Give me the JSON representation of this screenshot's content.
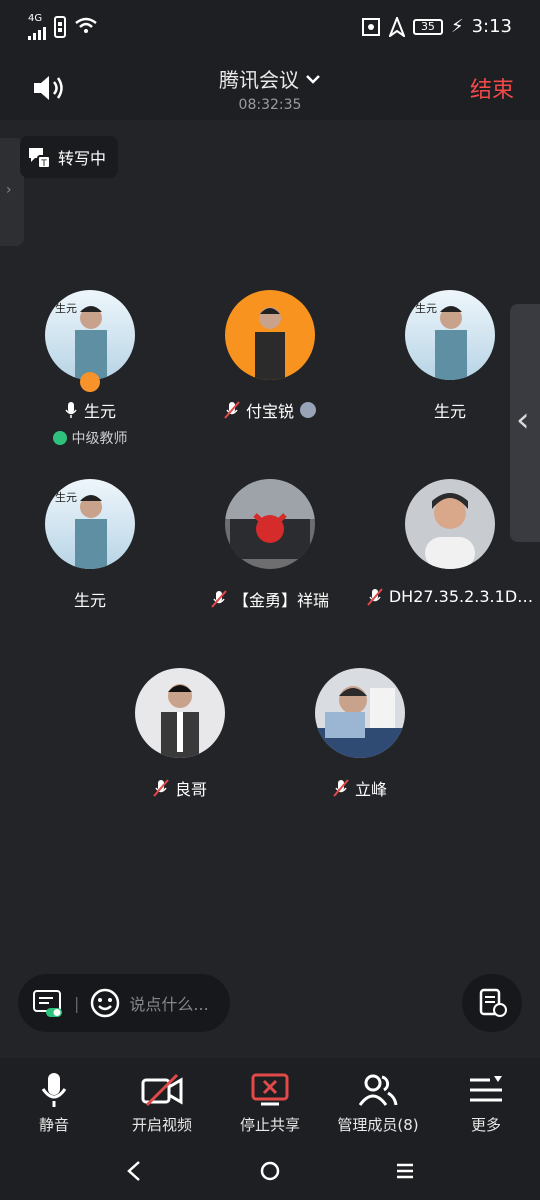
{
  "status_bar": {
    "network": "4G",
    "battery": "35",
    "time": "3:13"
  },
  "header": {
    "title": "腾讯会议",
    "timer": "08:32:35",
    "end_label": "结束"
  },
  "transcribe": {
    "label": "转写中"
  },
  "participants": [
    {
      "name": "生元",
      "sub": "中级教师",
      "avatar_color": "#cfe3f0",
      "mic": "on",
      "host": true
    },
    {
      "name": "付宝锐",
      "avatar_color": "#f7931e",
      "mic": "muted",
      "clock": true
    },
    {
      "name": "生元",
      "avatar_color": "#cfe3f0"
    },
    {
      "name": "生元",
      "avatar_color": "#cfe3f0"
    },
    {
      "name": "【金勇】祥瑞",
      "avatar_color": "#6e6e70",
      "mic": "muted"
    },
    {
      "name": "DH27.35.2.3.1D…",
      "avatar_color": "#c8ccd0",
      "mic": "muted"
    },
    {
      "name": "良哥",
      "avatar_color": "#e8e8ea",
      "mic": "muted"
    },
    {
      "name": "立峰",
      "avatar_color": "#d9dde2",
      "mic": "muted"
    }
  ],
  "input": {
    "placeholder": "说点什么..."
  },
  "toolbar": [
    {
      "label": "静音",
      "icon": "mic-icon"
    },
    {
      "label": "开启视频",
      "icon": "video-off-icon"
    },
    {
      "label": "停止共享",
      "icon": "stop-share-icon"
    },
    {
      "label": "管理成员(8)",
      "icon": "members-icon"
    },
    {
      "label": "更多",
      "icon": "more-icon"
    }
  ]
}
